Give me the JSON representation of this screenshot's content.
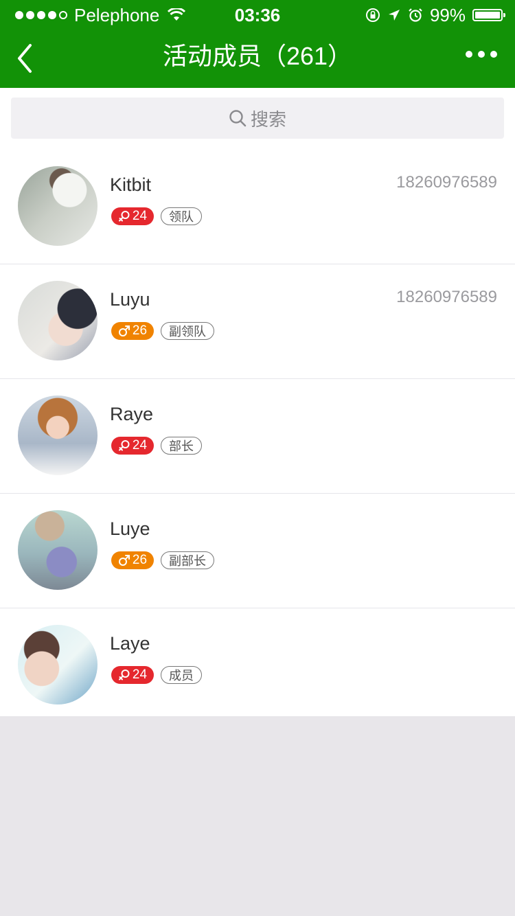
{
  "status_bar": {
    "carrier": "Pelephone",
    "time": "03:36",
    "battery": "99%",
    "battery_level": 0.99,
    "signal_bars": 4
  },
  "nav": {
    "title": "活动成员（261）"
  },
  "search": {
    "placeholder": "搜索"
  },
  "colors": {
    "header_green": "#129207",
    "female_red": "#e5282e",
    "male_orange": "#f08300"
  },
  "members": [
    {
      "name": "Kitbit",
      "phone": "18260976589",
      "gender": "female",
      "age": "24",
      "role": "领队"
    },
    {
      "name": "Luyu",
      "phone": "18260976589",
      "gender": "male",
      "age": "26",
      "role": "副领队"
    },
    {
      "name": "Raye",
      "phone": "",
      "gender": "female",
      "age": "24",
      "role": "部长"
    },
    {
      "name": "Luye",
      "phone": "",
      "gender": "male",
      "age": "26",
      "role": "副部长"
    },
    {
      "name": "Laye",
      "phone": "",
      "gender": "female",
      "age": "24",
      "role": "成员"
    }
  ]
}
